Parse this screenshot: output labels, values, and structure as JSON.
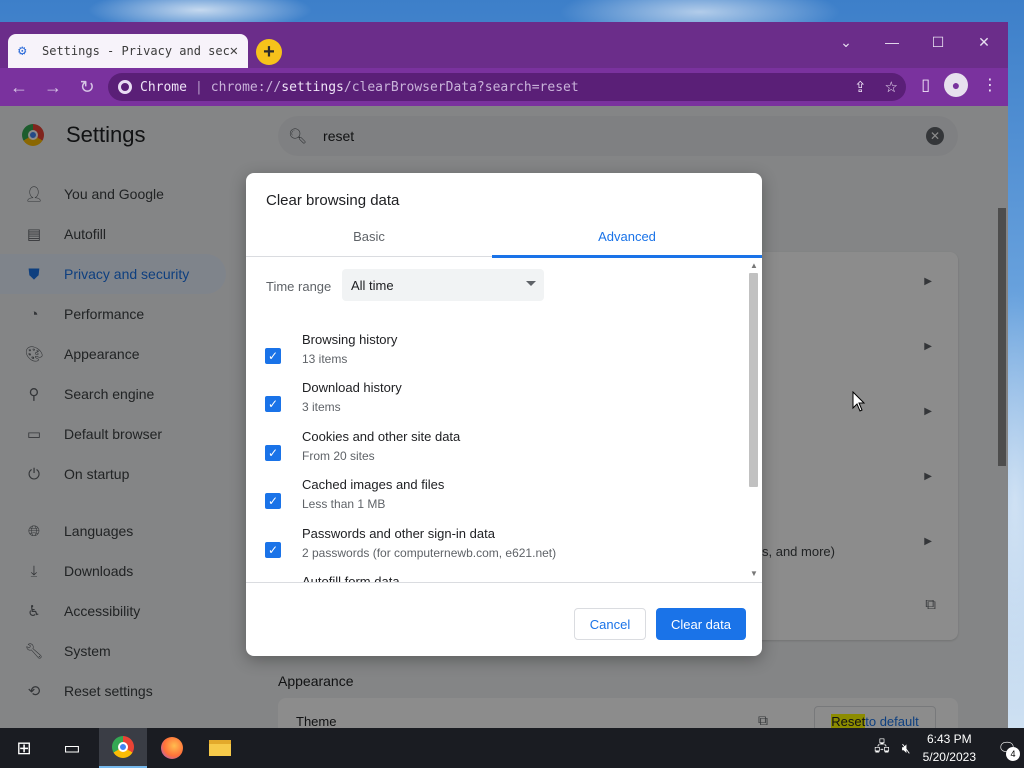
{
  "browser": {
    "tab_title": "Settings - Privacy and security",
    "tab_close": "✕",
    "new_tab": "+",
    "window_controls": {
      "dropdown": "⌄",
      "minimize": "—",
      "maximize": "☐",
      "close": "✕"
    },
    "omnibox": {
      "origin": "Chrome",
      "separator": "|",
      "url_prefix": "chrome://",
      "url_host": "settings",
      "url_path": "/clearBrowserData?search=reset"
    }
  },
  "settings": {
    "title": "Settings",
    "search_value": "reset",
    "sidebar": [
      {
        "label": "You and Google",
        "icon": "person-icon"
      },
      {
        "label": "Autofill",
        "icon": "clipboard-icon"
      },
      {
        "label": "Privacy and security",
        "icon": "shield-icon",
        "active": true
      },
      {
        "label": "Performance",
        "icon": "speedometer-icon"
      },
      {
        "label": "Appearance",
        "icon": "palette-icon"
      },
      {
        "label": "Search engine",
        "icon": "search-icon"
      },
      {
        "label": "Default browser",
        "icon": "browser-icon"
      },
      {
        "label": "On startup",
        "icon": "power-icon"
      },
      {
        "label": "Languages",
        "icon": "globe-icon"
      },
      {
        "label": "Downloads",
        "icon": "download-icon"
      },
      {
        "label": "Accessibility",
        "icon": "accessibility-icon"
      },
      {
        "label": "System",
        "icon": "wrench-icon"
      },
      {
        "label": "Reset settings",
        "icon": "history-icon"
      }
    ],
    "card_tail_text": "s, and more)",
    "section_heading": "Appearance",
    "theme_label": "Theme",
    "reset_highlight": "Reset",
    "reset_rest": " to default"
  },
  "dialog": {
    "title": "Clear browsing data",
    "tabs": {
      "basic": "Basic",
      "advanced": "Advanced",
      "active": "advanced"
    },
    "time_range_label": "Time range",
    "time_range_value": "All time",
    "items": [
      {
        "title": "Browsing history",
        "subtitle": "13 items",
        "checked": true
      },
      {
        "title": "Download history",
        "subtitle": "3 items",
        "checked": true
      },
      {
        "title": "Cookies and other site data",
        "subtitle": "From 20 sites",
        "checked": true
      },
      {
        "title": "Cached images and files",
        "subtitle": "Less than 1 MB",
        "checked": true
      },
      {
        "title": "Passwords and other sign-in data",
        "subtitle": "2 passwords (for computernewb.com, e621.net)",
        "checked": true
      },
      {
        "title": "Autofill form data",
        "subtitle": "",
        "checked": true
      }
    ],
    "cancel_label": "Cancel",
    "clear_label": "Clear data"
  },
  "taskbar": {
    "clock_time": "6:43 PM",
    "clock_date": "5/20/2023",
    "notification_count": "4"
  },
  "colors": {
    "accent": "#1a73e8",
    "theme_frame": "#6b2d8a",
    "theme_toolbar": "#7a329e"
  }
}
